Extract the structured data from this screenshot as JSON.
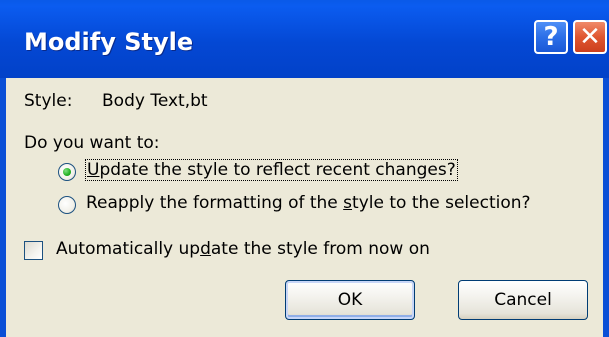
{
  "window": {
    "title": "Modify Style",
    "help_glyph": "?",
    "close_glyph": "✕"
  },
  "style": {
    "label": "Style:",
    "value": "Body Text,bt"
  },
  "question": "Do you want to:",
  "options": [
    {
      "accel": "U",
      "rest": "pdate the style to reflect recent changes?",
      "selected": true
    },
    {
      "pre": "Reapply the formatting of the ",
      "accel": "s",
      "rest": "tyle to the selection?",
      "selected": false
    }
  ],
  "auto_update": {
    "pre": "Automatically up",
    "accel": "d",
    "rest": "ate the style from now on",
    "checked": false
  },
  "buttons": {
    "ok": "OK",
    "cancel": "Cancel"
  },
  "colors": {
    "titlebar": "#0448d4",
    "dialog_face": "#ece9d8",
    "close_button": "#e05630",
    "radio_selected": "#22b022"
  }
}
